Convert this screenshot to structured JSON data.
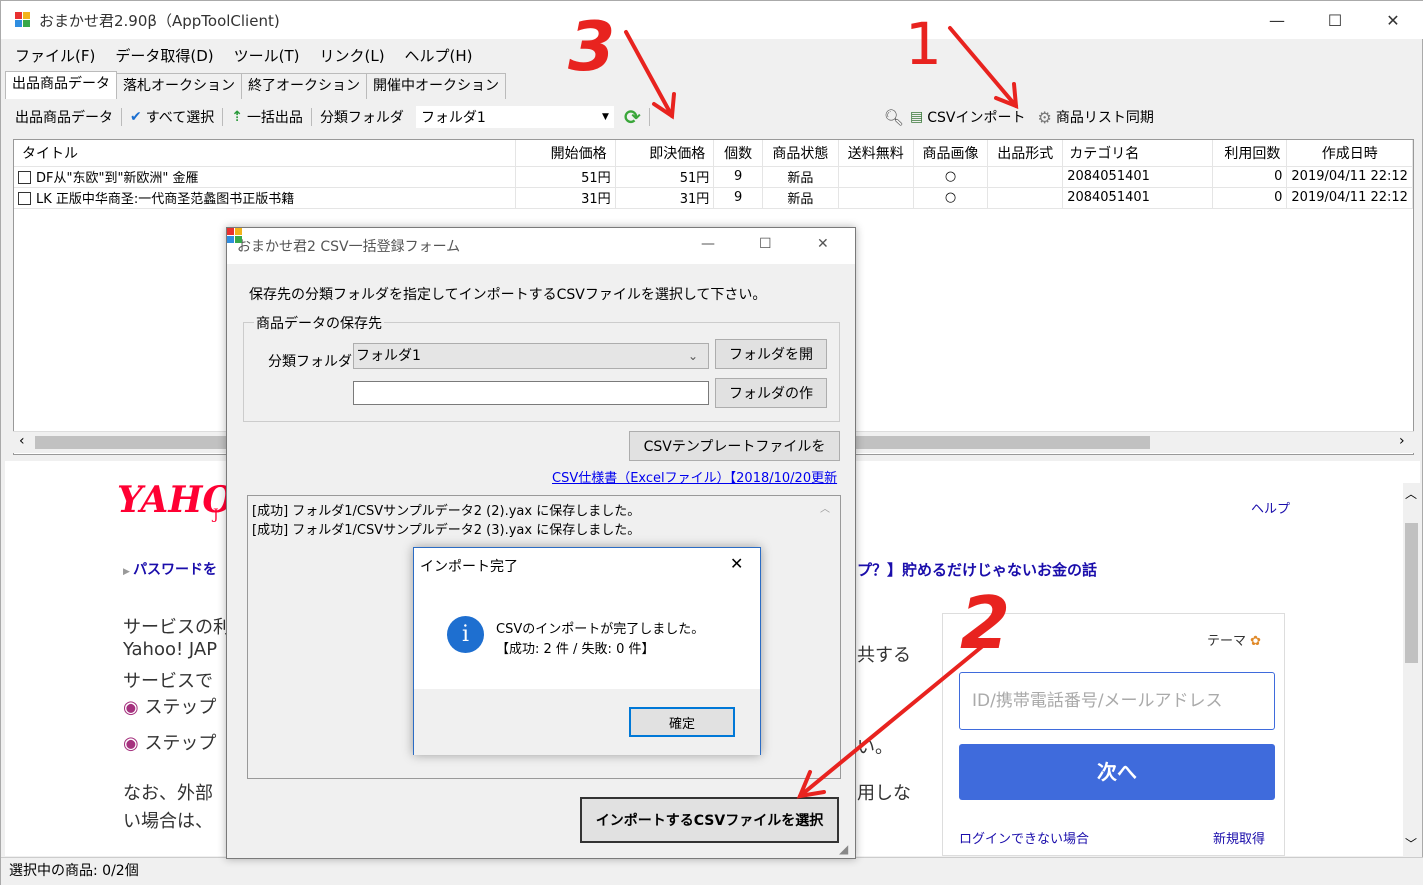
{
  "window": {
    "title": "おまかせ君2.90β（AppToolClient)",
    "controls": {
      "minimize": "—",
      "maximize": "☐",
      "close": "✕"
    }
  },
  "menu": [
    "ファイル(F)",
    "データ取得(D)",
    "ツール(T)",
    "リンク(L)",
    "ヘルプ(H)"
  ],
  "tabs": [
    "出品商品データ",
    "落札オークション",
    "終了オークション",
    "開催中オークション"
  ],
  "toolbar": {
    "label": "出品商品データ",
    "select_all": "すべて選択",
    "bulk_list": "一括出品",
    "folder_label": "分類フォルダ",
    "folder_value": "フォルダ1",
    "csv_import": "CSVインポート",
    "sync": "商品リスト同期"
  },
  "grid": {
    "headers": [
      "タイトル",
      "開始価格",
      "即決価格",
      "個数",
      "商品状態",
      "送料無料",
      "商品画像",
      "出品形式",
      "カテゴリ名",
      "利用回数",
      "作成日時"
    ],
    "rows": [
      [
        "DF从\"东欧\"到\"新欧洲\" 金雁",
        "51円",
        "51円",
        "9",
        "新品",
        "",
        "○",
        "",
        "2084051401",
        "0",
        "2019/04/11 22:12"
      ],
      [
        "LK 正版中华商圣:一代商圣范蠡图书正版书籍",
        "31円",
        "31円",
        "9",
        "新品",
        "",
        "○",
        "",
        "2084051401",
        "0",
        "2019/04/11 22:12"
      ]
    ]
  },
  "browser": {
    "logo": "YAHO",
    "logo_sub": "J",
    "help": "ヘルプ",
    "password_link": "パスワードを",
    "promo": "プ？】貯めるだけじゃないお金の話",
    "lines": [
      "サービスの利",
      "Yahoo! JAP",
      "サービスで",
      "ステップ",
      "ステップ",
      "なお、外部",
      "い場合は、"
    ],
    "shared": "共する",
    "dot": "い。",
    "noshi": "用しな",
    "login": {
      "theme": "テーマ",
      "placeholder": "ID/携帯電話番号/メールアドレス",
      "next": "次へ",
      "cannot_login": "ログインできない場合",
      "register": "新規取得"
    }
  },
  "status": "選択中の商品: 0/2個",
  "csv_dialog": {
    "title": "おまかせ君2 CSV一括登録フォーム",
    "instruction": "保存先の分類フォルダを指定してインポートするCSVファイルを選択して下さい。",
    "group_label": "商品データの保存先",
    "folder_label": "分類フォルダ",
    "folder_value": "フォルダ1",
    "open_folder": "フォルダを開",
    "new_folder_input": "",
    "create_folder": "フォルダの作",
    "template_button": "CSVテンプレートファイルを",
    "spec_link": "CSV仕様書（Excelファイル）【2018/10/20更新",
    "log": [
      "[成功] フォルダ1/CSVサンプルデータ2 (2).yax に保存しました。",
      "[成功] フォルダ1/CSVサンプルデータ2 (3).yax に保存しました。"
    ],
    "select_button": "インポートするCSVファイルを選択"
  },
  "message_box": {
    "title": "インポート完了",
    "line1": "CSVのインポートが完了しました。",
    "line2": "【成功: 2 件 / 失敗: 0 件】",
    "ok": "確定"
  },
  "annotations": [
    "3",
    "1",
    "2"
  ],
  "colors": {
    "arrow": "#e8231f",
    "link": "#1a0dab",
    "yahoo_red": "#ff0033",
    "next_button": "#3f6bdc",
    "info_icon": "#1e6fd0"
  }
}
